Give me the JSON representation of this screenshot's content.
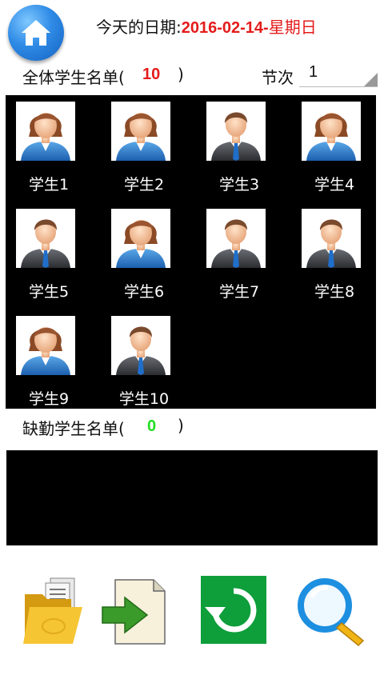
{
  "header": {
    "home_icon": "home-icon",
    "date_label": "今天的日期:",
    "date_value": "2016-02-14-",
    "weekday": "星期日"
  },
  "all_students": {
    "label": "全体学生名单(",
    "count": "10",
    "close": ")"
  },
  "section": {
    "label": "节次",
    "value": "1"
  },
  "students": [
    {
      "name": "学生1",
      "avatar": "female-avatar-icon"
    },
    {
      "name": "学生2",
      "avatar": "female-avatar-icon"
    },
    {
      "name": "学生3",
      "avatar": "male-avatar-icon"
    },
    {
      "name": "学生4",
      "avatar": "female-avatar-icon"
    },
    {
      "name": "学生5",
      "avatar": "male-avatar-icon"
    },
    {
      "name": "学生6",
      "avatar": "female-avatar-icon"
    },
    {
      "name": "学生7",
      "avatar": "male-avatar-icon"
    },
    {
      "name": "学生8",
      "avatar": "male-avatar-icon"
    },
    {
      "name": "学生9",
      "avatar": "female-avatar-icon"
    },
    {
      "name": "学生10",
      "avatar": "male-avatar-icon"
    }
  ],
  "absent_students": {
    "label": "缺勤学生名单(",
    "count": "0",
    "close": ")"
  },
  "toolbar": {
    "icons": [
      "folder-icon",
      "export-icon",
      "refresh-icon",
      "search-icon"
    ]
  },
  "colors": {
    "accent_red": "#e41b1b",
    "accent_green": "#22dd22",
    "panel_bg": "#000000",
    "refresh_green": "#0e9e3a"
  }
}
